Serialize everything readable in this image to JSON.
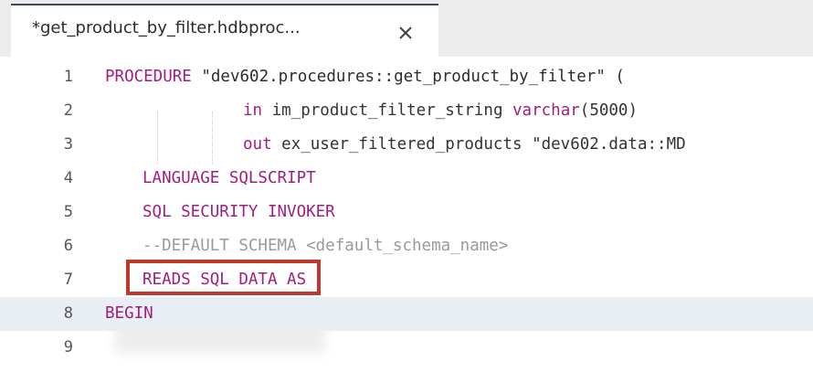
{
  "tab": {
    "title": "*get_product_by_filter.hdbproc...",
    "close_glyph": "×",
    "close_icon": "close-icon"
  },
  "editor": {
    "current_line": 8,
    "lines": [
      {
        "n": "1",
        "tokens": [
          {
            "t": "PROCEDURE",
            "c": "kw"
          },
          {
            "t": " \"dev602.procedures::get_product_by_filter\" (",
            "c": "str"
          }
        ]
      },
      {
        "n": "2",
        "tokens": [
          {
            "t": "in",
            "c": "kw"
          },
          {
            "t": " im_product_filter_string ",
            "c": "plain"
          },
          {
            "t": "varchar",
            "c": "kw"
          },
          {
            "t": "(5000)",
            "c": "plain"
          }
        ]
      },
      {
        "n": "3",
        "tokens": [
          {
            "t": "out",
            "c": "kw"
          },
          {
            "t": " ex_user_filtered_products \"dev602.data::MD",
            "c": "plain"
          }
        ]
      },
      {
        "n": "4",
        "tokens": [
          {
            "t": "LANGUAGE SQLSCRIPT",
            "c": "kw"
          }
        ]
      },
      {
        "n": "5",
        "tokens": [
          {
            "t": "SQL SECURITY INVOKER",
            "c": "kw"
          }
        ]
      },
      {
        "n": "6",
        "tokens": [
          {
            "t": "--DEFAULT SCHEMA <default_schema_name>",
            "c": "comment"
          }
        ]
      },
      {
        "n": "7",
        "tokens": [
          {
            "t": "READS SQL DATA AS",
            "c": "kw"
          }
        ]
      },
      {
        "n": "8",
        "tokens": [
          {
            "t": "BEGIN",
            "c": "kw"
          }
        ]
      },
      {
        "n": "9",
        "tokens": []
      }
    ]
  },
  "colors": {
    "keyword": "#a01e7e",
    "highlight_border": "#c0382b",
    "current_line_bg": "#e8eef3"
  }
}
